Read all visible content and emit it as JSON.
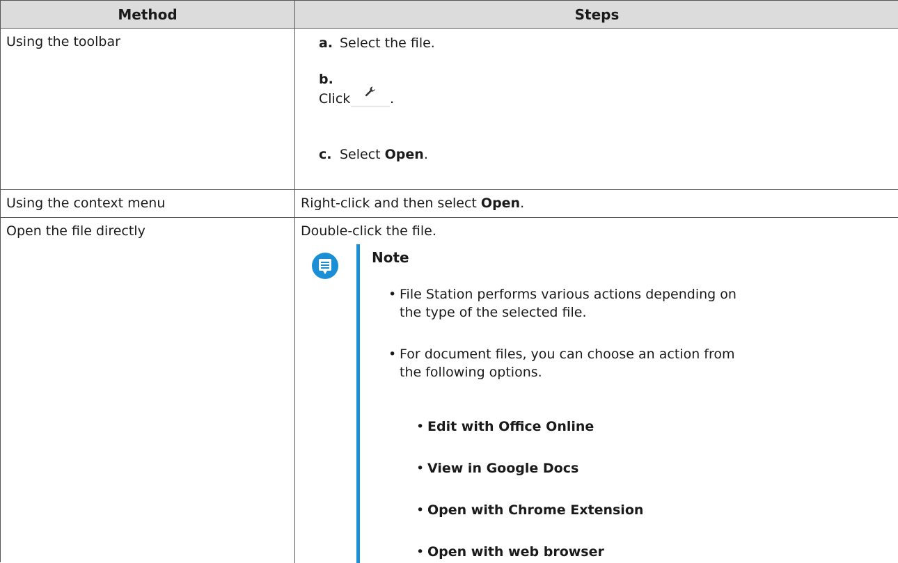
{
  "table": {
    "headers": {
      "method": "Method",
      "steps": "Steps"
    },
    "rows": [
      {
        "method": "Using the toolbar",
        "steps": [
          {
            "letter": "a.",
            "text": "Select the file."
          },
          {
            "letter": "b.",
            "text_before": "Click",
            "icon": "wrench-icon",
            "text_after": "."
          },
          {
            "letter": "c.",
            "text_before": "Select ",
            "bold": "Open",
            "text_after": "."
          }
        ]
      },
      {
        "method": "Using the context menu",
        "steps_before": "Right-click and then select ",
        "steps_bold": "Open",
        "steps_after": "."
      },
      {
        "method": "Open the file directly",
        "steps_text": "Double-click the file.",
        "note": {
          "title": "Note",
          "icon": "note-icon",
          "bullets": [
            {
              "line1": "File Station performs various actions depending on",
              "line2": "the type of the selected file."
            },
            {
              "line1": "For document files, you can choose an action from",
              "line2": "the following options."
            }
          ],
          "options": [
            "Edit with Office Online",
            "View in Google Docs",
            "Open with Chrome Extension",
            "Open with web browser"
          ]
        }
      }
    ]
  },
  "colors": {
    "header_bg": "#dcdcdc",
    "note_accent": "#1a8fd6"
  }
}
